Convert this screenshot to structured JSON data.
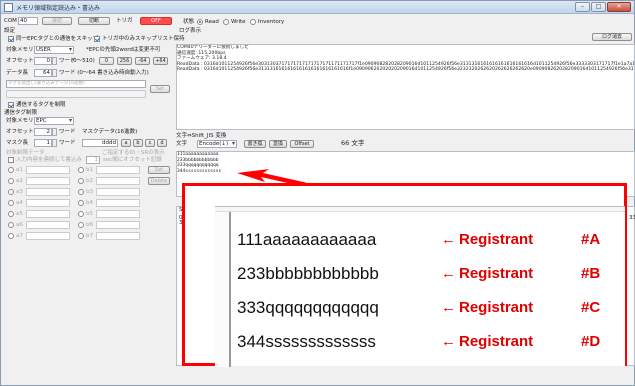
{
  "window": {
    "title": "メモリ領域指定読込み・書込み",
    "min": "–",
    "max": "□",
    "close": "✕"
  },
  "top": {
    "com_label": "COM",
    "com_value": "40",
    "open_label": "接続",
    "cut_label": "切断",
    "trig_label": "トリガ",
    "trig_value": "OFF"
  },
  "settings": {
    "title": "設定",
    "epc_skip": "同一EPCタグとの通信をスキップ",
    "trigger_skip": "トリガ中のみスキップリスト保持",
    "target_mem_label": "対象メモリ",
    "target_mem_value": "USER",
    "epc_note": "*EPCの先頭2wordは変更不可",
    "offset_label": "オフセット",
    "offset_value": "0",
    "word_label": "ワード",
    "offset_range": "(0〜510)",
    "preset_0": "0",
    "preset_256": "256",
    "preset_m64": "-64",
    "preset_p64": "+64",
    "data_len_label": "データ長",
    "data_len_value": "64",
    "data_len_note": "ワード (0〜64 書き込み時自動入力)",
    "tag_input_note": "タグを読出し(書き込みデータ16進数)",
    "set_button": "Set"
  },
  "limit": {
    "check_label": "通信するタグを制限",
    "title": "通信タグ制限",
    "target_mem_label": "対象メモリ",
    "target_mem_value": "EPC",
    "offset_label": "オフセット",
    "offset_value": "2",
    "word_label": "ワード",
    "mask_label": "マスクデータ(16進数)",
    "mask_len_label": "マスク長",
    "mask_len_value": "1",
    "mask_value": "dddd",
    "mask_buttons": [
      "a",
      "b",
      "c",
      "d"
    ]
  },
  "multi": {
    "note_left": "対象制限テータ",
    "note_right": "ご指定するID・SRの表示",
    "input_note": "入力内容を連続して書込み",
    "sec_note": "sec間にオフセット記録",
    "sec_value": "1",
    "set_button": "Set",
    "delete_button": "Delete",
    "left_items": [
      "a1",
      "a2",
      "a3",
      "a4",
      "a5",
      "a6",
      "a7"
    ],
    "right_items": [
      "b1",
      "b2",
      "b3",
      "b4",
      "b5",
      "b6",
      "b7"
    ]
  },
  "mode": {
    "label": "状態",
    "read": "Read",
    "write": "Write",
    "inventory": "Inventory"
  },
  "log": {
    "title": "ログ表示",
    "clear_button": "ログ消去",
    "lines": [
      "COM40デリーダーに接続しました",
      "通信速度: 115,200bps",
      "ファームウェア: 3.18.4",
      "ReadData : 0316d1011254926f56e3031303717171717171717171171171717f1e090908282028209016d1011254926f56e3131316161616161616161616d1011254926f56e3333303171717f1e1a7a1a7a7a",
      "ReadData : 0316d1011254926f56e3131316161616161616161616161616f1e09090620202020209016d1011254926f56e3232320262620262626262620e090908262028209016d1011254926f56e3131313171717f1e1a7a1a7a7a"
    ]
  },
  "text_section": {
    "label": "文字⇔Shift_JIS 変換",
    "char_label": "文字",
    "encode_value": "Encode(↓)",
    "convert_button": "書き換",
    "change_button": "変換",
    "offset_button": "Offset",
    "count": "66 文字",
    "lines": [
      "111aaaaaaaaaaaa",
      "233bbbbbbbbbbbb",
      "333qqqqqqqqqqqq",
      "344sssssssssssss"
    ]
  },
  "shift": {
    "label": "Shift",
    "line1": "0316",
    "line2": "3333",
    "tail": "33"
  },
  "zoom": {
    "rows": [
      {
        "code": "111aaaaaaaaaaaa",
        "arrow": "←",
        "registrant": "Registrant",
        "id": "#A"
      },
      {
        "code": "233bbbbbbbbbbbb",
        "arrow": "←",
        "registrant": "Registrant",
        "id": "#B"
      },
      {
        "code": "333qqqqqqqqqqqq",
        "arrow": "←",
        "registrant": "Registrant",
        "id": "#C"
      },
      {
        "code": "344sssssssssssss",
        "arrow": "←",
        "registrant": "Registrant",
        "id": "#D"
      }
    ]
  },
  "colors": {
    "accent_red": "#ff0000",
    "trigger_bg": "#ff4b4b"
  }
}
